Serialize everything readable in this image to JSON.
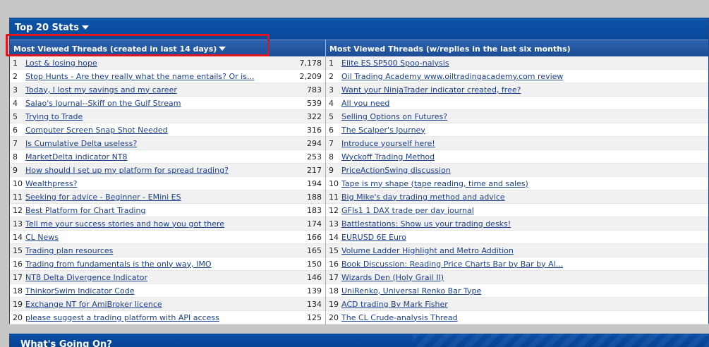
{
  "stats": {
    "title": "Top 20 Stats",
    "left": {
      "heading": "Most Viewed Threads (created in last 14 days)",
      "rows": [
        {
          "rank": "1",
          "title": "Lost & losing hope",
          "views": "7,178"
        },
        {
          "rank": "2",
          "title": "Stop Hunts - Are they really what the name entails? Or is...",
          "views": "2,209"
        },
        {
          "rank": "3",
          "title": "Today, I lost my savings and my career",
          "views": "783"
        },
        {
          "rank": "4",
          "title": "Salao's Journal--Skiff on the Gulf Stream",
          "views": "539"
        },
        {
          "rank": "5",
          "title": "Trying to Trade",
          "views": "322"
        },
        {
          "rank": "6",
          "title": "Computer Screen Snap Shot Needed",
          "views": "316"
        },
        {
          "rank": "7",
          "title": "Is Cumulative Delta useless?",
          "views": "294"
        },
        {
          "rank": "8",
          "title": "MarketDelta indicator NT8",
          "views": "253"
        },
        {
          "rank": "9",
          "title": "How should I set up my platform for spread trading?",
          "views": "217"
        },
        {
          "rank": "10",
          "title": "Wealthpress?",
          "views": "194"
        },
        {
          "rank": "11",
          "title": "Seeking for advice - Beginner - EMini ES",
          "views": "188"
        },
        {
          "rank": "12",
          "title": "Best Platform for Chart Trading",
          "views": "183"
        },
        {
          "rank": "13",
          "title": "Tell me your success stories and how you got there",
          "views": "174"
        },
        {
          "rank": "14",
          "title": "CL News",
          "views": "166"
        },
        {
          "rank": "15",
          "title": "Trading plan resources",
          "views": "165"
        },
        {
          "rank": "16",
          "title": "Trading from fundamentals is the only way, IMO",
          "views": "150"
        },
        {
          "rank": "17",
          "title": "NT8 Delta Divergence Indicator",
          "views": "146"
        },
        {
          "rank": "18",
          "title": "ThinkorSwim Indicator Code",
          "views": "139"
        },
        {
          "rank": "19",
          "title": "Exchange NT for AmiBroker licence",
          "views": "134"
        },
        {
          "rank": "20",
          "title": "please suggest a trading platform with API access",
          "views": "125"
        }
      ]
    },
    "right": {
      "heading": "Most Viewed Threads (w/replies in the last six months)",
      "rows": [
        {
          "rank": "1",
          "title": "Elite ES SP500 Spoo-nalysis"
        },
        {
          "rank": "2",
          "title": "Oil Trading Academy www.oiltradingacademy.com review"
        },
        {
          "rank": "3",
          "title": "Want your NinjaTrader indicator created, free?"
        },
        {
          "rank": "4",
          "title": "All you need"
        },
        {
          "rank": "5",
          "title": "Selling Options on Futures?"
        },
        {
          "rank": "6",
          "title": "The Scalper's Journey"
        },
        {
          "rank": "7",
          "title": "Introduce yourself here!"
        },
        {
          "rank": "8",
          "title": "Wyckoff Trading Method"
        },
        {
          "rank": "9",
          "title": "PriceActionSwing discussion"
        },
        {
          "rank": "10",
          "title": "Tape is my shape (tape reading, time and sales)"
        },
        {
          "rank": "11",
          "title": "Big Mike's day trading method and advice"
        },
        {
          "rank": "12",
          "title": "GFIs1 1 DAX trade per day journal"
        },
        {
          "rank": "13",
          "title": "Battlestations: Show us your trading desks!"
        },
        {
          "rank": "14",
          "title": "EURUSD 6E Euro"
        },
        {
          "rank": "15",
          "title": "Volume Ladder Highlight and Metro Addition"
        },
        {
          "rank": "16",
          "title": "Book Discussion: Reading Price Charts Bar by Bar by Al..."
        },
        {
          "rank": "17",
          "title": "Wizards Den (Holy Grail II)"
        },
        {
          "rank": "18",
          "title": "UniRenko, Universal Renko Bar Type"
        },
        {
          "rank": "19",
          "title": "ACD trading By Mark Fisher"
        },
        {
          "rank": "20",
          "title": "The CL Crude-analysis Thread"
        }
      ]
    }
  },
  "whats_going_on": {
    "title": "What's Going On?"
  },
  "colors": {
    "header_blue": "#0e55a8",
    "link": "#1b3f8f",
    "highlight": "#e3141b"
  }
}
